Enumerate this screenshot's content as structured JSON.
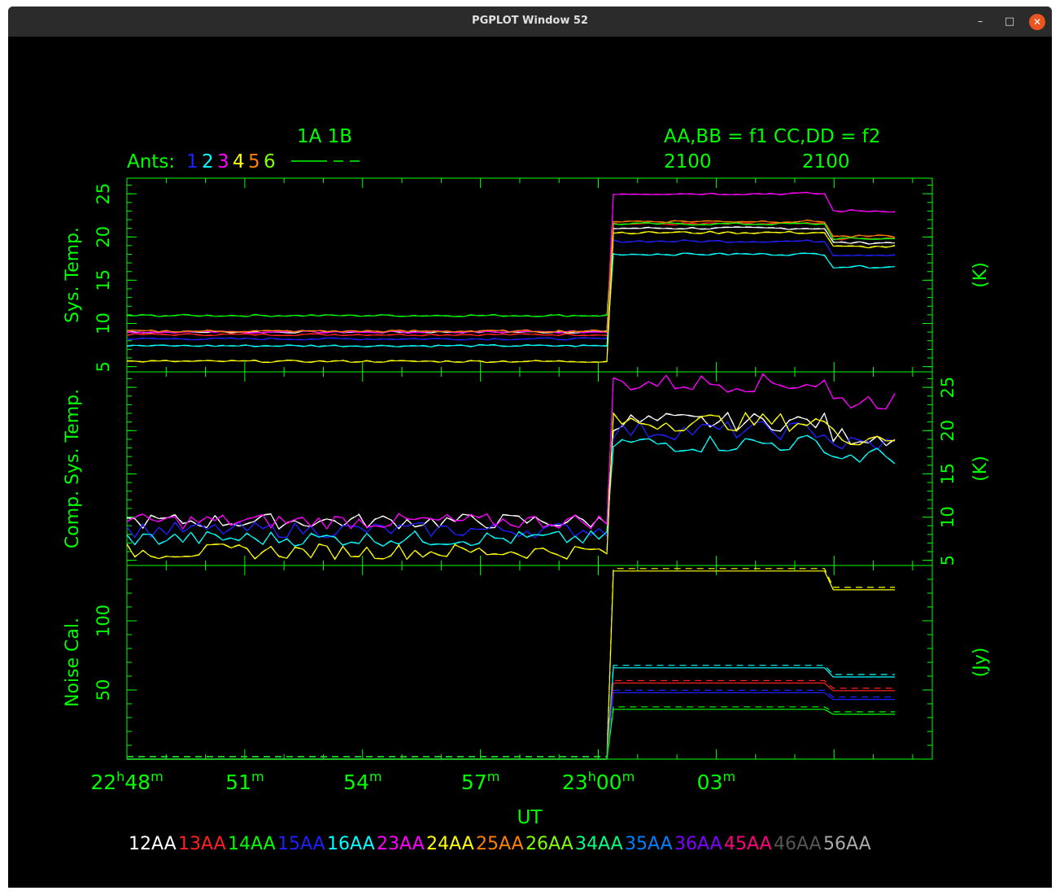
{
  "window": {
    "title": "PGPLOT Window 52",
    "minimize_icon": "minimize-icon",
    "maximize_icon": "maximize-icon",
    "close_icon": "close-icon"
  },
  "colors": {
    "axis": "#00ff00",
    "background": "#000000",
    "ant1": "#ffffff",
    "ant2": "#ff2020",
    "ant3": "#00ff00",
    "ant4": "#2020ff",
    "ant5": "#00ffff",
    "ant6": "#ff00ff",
    "ant7": "#ffff00",
    "ant8": "#ff8000",
    "ant9": "#80ff00",
    "ant10": "#00ff80",
    "ant11": "#0080ff",
    "ant12": "#8000ff",
    "ant13": "#808080"
  },
  "header": {
    "left_top": "1A  1B",
    "ants_label": "Ants:",
    "ants_digits": [
      "1",
      "2",
      "3",
      "4",
      "5",
      "6"
    ],
    "ants_digit_colors": [
      "#2020ff",
      "#00ffff",
      "#ff00ff",
      "#ffff00",
      "#ff8000",
      "#80ff00"
    ],
    "right_top": "AA,BB = f1  CC,DD = f2",
    "freq1": "2100",
    "freq2": "2100"
  },
  "chart_data": [
    {
      "type": "line",
      "ylabel": "Sys. Temp.",
      "ylabel_right": "(K)",
      "ylim": [
        4.4,
        26.8
      ],
      "yticks": [
        5,
        10,
        15,
        20,
        25
      ],
      "x": [
        0,
        10
      ],
      "series_summary": [
        {
          "name": "12AA",
          "before": 9.0,
          "after": 21.0
        },
        {
          "name": "13AA",
          "before": 8.7,
          "after": 21.5
        },
        {
          "name": "14AA",
          "before": 10.9,
          "after": 21.5
        },
        {
          "name": "15AA",
          "before": 8.2,
          "after": 19.5
        },
        {
          "name": "16AA",
          "before": 7.4,
          "after": 18.0
        },
        {
          "name": "23AA",
          "before": 9.0,
          "after": 25.0
        },
        {
          "name": "24AA",
          "before": 5.6,
          "after": 20.5
        },
        {
          "name": "25AA",
          "before": 9.1,
          "after": 21.8
        }
      ]
    },
    {
      "type": "line",
      "ylabel": "Comp. Sys. Temp.",
      "ylabel_right": "(K)",
      "ylim": [
        4.4,
        26.8
      ],
      "yticks": [
        5,
        10,
        15,
        20,
        25
      ],
      "series_summary": [
        {
          "name": "12AA",
          "before": 9.5,
          "after": 21.0
        },
        {
          "name": "15AA",
          "before": 8.5,
          "after": 20.0
        },
        {
          "name": "16AA",
          "before": 7.5,
          "after": 18.5
        },
        {
          "name": "23AA",
          "before": 9.5,
          "after": 25.5
        },
        {
          "name": "24AA",
          "before": 6.0,
          "after": 21.0
        }
      ]
    },
    {
      "type": "line",
      "ylabel": "Noise Cal.",
      "ylabel_right": "(Jy)",
      "ylim": [
        0,
        140
      ],
      "yticks": [
        50,
        100
      ],
      "series_summary": [
        {
          "name": "24AA",
          "before": 0,
          "after": 136
        },
        {
          "name": "16AA",
          "before": 0,
          "after": 66
        },
        {
          "name": "13AA",
          "before": 0,
          "after": 55
        },
        {
          "name": "15AA",
          "before": 0,
          "after": 48
        },
        {
          "name": "14AA",
          "before": 0,
          "after": 36
        }
      ]
    }
  ],
  "xaxis": {
    "label": "UT",
    "ticks": [
      {
        "main": "22",
        "sup1": "h",
        "mid": "48",
        "sup2": "m"
      },
      {
        "main": "51",
        "sup1": "",
        "mid": "",
        "sup2": "m"
      },
      {
        "main": "54",
        "sup1": "",
        "mid": "",
        "sup2": "m"
      },
      {
        "main": "57",
        "sup1": "",
        "mid": "",
        "sup2": "m"
      },
      {
        "main": "23",
        "sup1": "h",
        "mid": "00",
        "sup2": "m"
      },
      {
        "main": "03",
        "sup1": "",
        "mid": "",
        "sup2": "m"
      }
    ]
  },
  "legend": [
    {
      "label": "12AA",
      "color": "#ffffff"
    },
    {
      "label": "13AA",
      "color": "#ff2020"
    },
    {
      "label": "14AA",
      "color": "#00ff00"
    },
    {
      "label": "15AA",
      "color": "#2020ff"
    },
    {
      "label": "16AA",
      "color": "#00ffff"
    },
    {
      "label": "23AA",
      "color": "#ff00ff"
    },
    {
      "label": "24AA",
      "color": "#ffff00"
    },
    {
      "label": "25AA",
      "color": "#ff8000"
    },
    {
      "label": "26AA",
      "color": "#80ff00"
    },
    {
      "label": "34AA",
      "color": "#00ff80"
    },
    {
      "label": "35AA",
      "color": "#0080ff"
    },
    {
      "label": "36AA",
      "color": "#8000ff"
    },
    {
      "label": "45AA",
      "color": "#ff0080"
    },
    {
      "label": "46AA",
      "color": "#555555"
    },
    {
      "label": "56AA",
      "color": "#aaaaaa"
    }
  ]
}
